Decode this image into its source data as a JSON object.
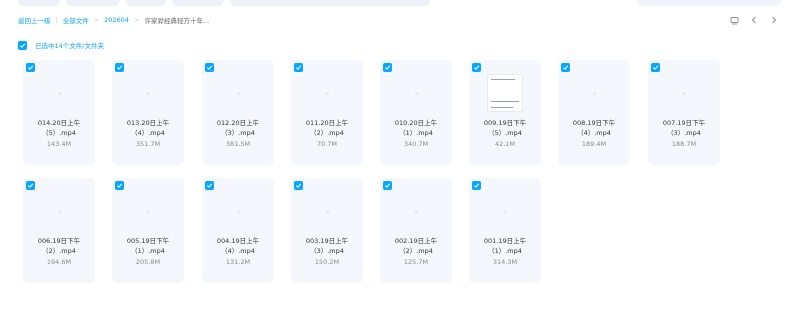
{
  "breadcrumb": {
    "back_label": "返回上一级",
    "items": [
      "全部文件",
      "202604",
      "许家骅经典轻方十年..."
    ]
  },
  "selection": {
    "label": "已选中14个文件/文件夹"
  },
  "colors": {
    "accent": "#06a7ff",
    "tile_bg": "#f4f8fc"
  },
  "icons": {
    "check": "check-icon",
    "sort": "sort-icon",
    "back": "chevron-left-icon",
    "forward": "chevron-right-icon"
  },
  "files": [
    {
      "name_line1": "014.20日上午",
      "name_line2": "（5）.mp4",
      "size": "143.4M"
    },
    {
      "name_line1": "013.20日上午",
      "name_line2": "（4）.mp4",
      "size": "351.7M"
    },
    {
      "name_line1": "012.20日上午",
      "name_line2": "（3）.mp4",
      "size": "381.5M"
    },
    {
      "name_line1": "011.20日上午",
      "name_line2": "（2）.mp4",
      "size": "70.7M"
    },
    {
      "name_line1": "010.20日上午",
      "name_line2": "（1）.mp4",
      "size": "340.7M"
    },
    {
      "name_line1": "009.19日下午",
      "name_line2": "（5）.mp4",
      "size": "42.1M"
    },
    {
      "name_line1": "008.19日下午",
      "name_line2": "（4）.mp4",
      "size": "189.4M"
    },
    {
      "name_line1": "007.19日下午",
      "name_line2": "（3）.mp4",
      "size": "188.7M"
    },
    {
      "name_line1": "006.19日下午",
      "name_line2": "（2）.mp4",
      "size": "194.6M"
    },
    {
      "name_line1": "005.19日下午",
      "name_line2": "（1）.mp4",
      "size": "205.8M"
    },
    {
      "name_line1": "004.19日上午",
      "name_line2": "（4）.mp4",
      "size": "131.2M"
    },
    {
      "name_line1": "003.19日上午",
      "name_line2": "（3）.mp4",
      "size": "150.2M"
    },
    {
      "name_line1": "002.19日上午",
      "name_line2": "（2）.mp4",
      "size": "125.7M"
    },
    {
      "name_line1": "001.19日上午",
      "name_line2": "（1）.mp4",
      "size": "314.3M"
    }
  ]
}
